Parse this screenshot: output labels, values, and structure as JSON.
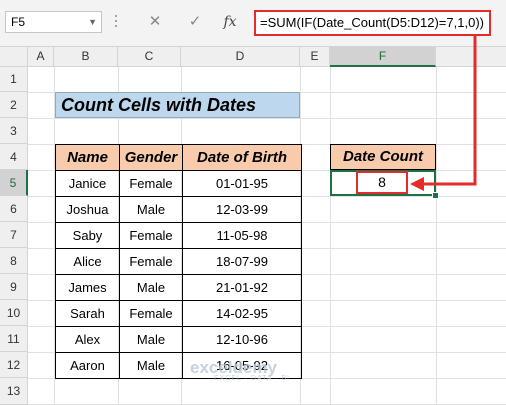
{
  "formula_bar": {
    "name_box": "F5",
    "cancel_symbol": "✕",
    "enter_symbol": "✓",
    "fx_symbol": "fx",
    "formula": "=SUM(IF(Date_Count(D5:D12)=7,1,0))"
  },
  "columns": [
    "A",
    "B",
    "C",
    "D",
    "E",
    "F"
  ],
  "rows": [
    "1",
    "2",
    "3",
    "4",
    "5",
    "6",
    "7",
    "8",
    "9",
    "10",
    "11",
    "12",
    "13"
  ],
  "selected_column": "F",
  "selected_row": "5",
  "title": "Count  Cells with Dates",
  "table": {
    "headers": [
      "Name",
      "Gender",
      "Date of Birth"
    ],
    "rows": [
      [
        "Janice",
        "Female",
        "01-01-95"
      ],
      [
        "Joshua",
        "Male",
        "12-03-99"
      ],
      [
        "Saby",
        "Female",
        "11-05-98"
      ],
      [
        "Alice",
        "Female",
        "18-07-99"
      ],
      [
        "James",
        "Male",
        "21-01-92"
      ],
      [
        "Sarah",
        "Female",
        "14-02-95"
      ],
      [
        "Alex",
        "Male",
        "12-10-96"
      ],
      [
        "Aaron",
        "Male",
        "16-05-92"
      ]
    ]
  },
  "date_count": {
    "header": "Date Count",
    "value": "8"
  },
  "accent_colors": {
    "highlight_red": "#e32b2b",
    "selection_green": "#1e7145",
    "header_peach": "#f8cbad",
    "title_blue": "#bdd7ee"
  },
  "watermark": {
    "brand": "exceldemy",
    "tagline": "EXCEL · DATA · BI"
  }
}
